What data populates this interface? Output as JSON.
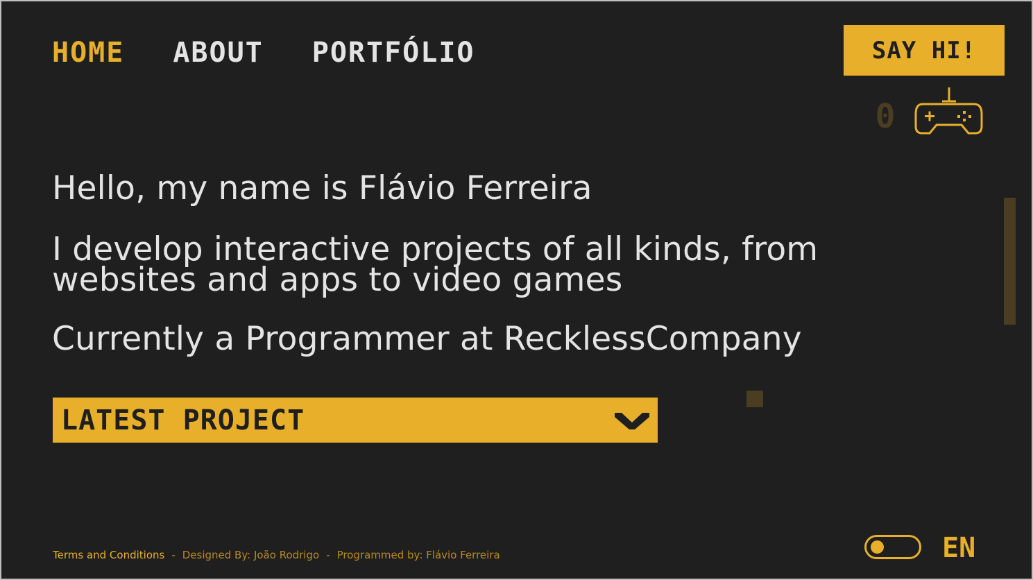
{
  "nav": {
    "items": [
      {
        "label": "HOME",
        "active": true
      },
      {
        "label": "ABOUT",
        "active": false
      },
      {
        "label": "PORTFÓLIO",
        "active": false
      }
    ]
  },
  "header": {
    "cta_label": "SAY HI!",
    "score": "0",
    "controller_icon": "gamepad-icon"
  },
  "intro": {
    "line1": "Hello, my name is Flávio Ferreira",
    "line2": "I develop interactive projects of all kinds, from websites and apps to video games",
    "line3": "Currently a Programmer at RecklessCompany"
  },
  "latest_project": {
    "label": "LATEST PROJECT",
    "icon": "chevron-down-icon"
  },
  "footer": {
    "terms": "Terms and Conditions",
    "separator": "-",
    "designed_by": "Designed By: João Rodrigo",
    "programmed_by": "Programmed by: Flávio Ferreira"
  },
  "settings": {
    "theme_toggle_icon": "toggle-switch-icon",
    "language": "EN"
  },
  "colors": {
    "background": "#1f1f1f",
    "accent": "#e8b02a",
    "text": "#e4e4e4",
    "muted_accent": "#4a3d22"
  }
}
